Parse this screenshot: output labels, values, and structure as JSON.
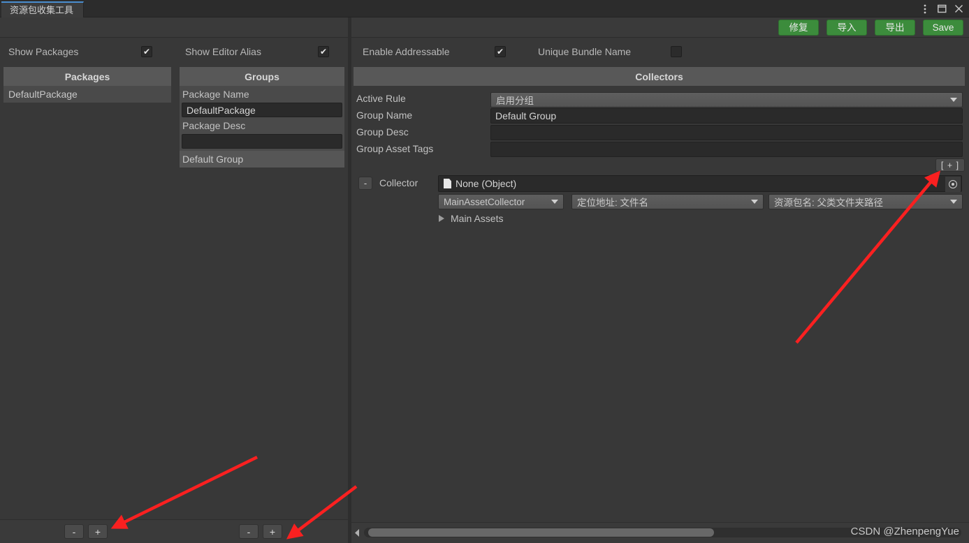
{
  "window": {
    "tab_title": "资源包收集工具",
    "controls": [
      "menu-dots",
      "maximize",
      "close"
    ]
  },
  "toolbar": {
    "buttons": [
      {
        "label": "修复",
        "color": "#3c8c3c"
      },
      {
        "label": "导入",
        "color": "#3c8c3c"
      },
      {
        "label": "导出",
        "color": "#3c8c3c"
      },
      {
        "label": "Save",
        "color": "#3c8c3c"
      }
    ]
  },
  "options": [
    {
      "label": "Show Packages",
      "checked": true
    },
    {
      "label": "Show Editor Alias",
      "checked": true
    },
    {
      "label": "Enable Addressable",
      "checked": true
    },
    {
      "label": "Unique Bundle Name",
      "checked": false
    }
  ],
  "packages_panel": {
    "header": "Packages",
    "items": [
      "DefaultPackage"
    ]
  },
  "groups_panel": {
    "header": "Groups",
    "package_name_label": "Package Name",
    "package_name_value": "DefaultPackage",
    "package_desc_label": "Package Desc",
    "package_desc_value": "",
    "items": [
      "Default Group"
    ]
  },
  "collectors_panel": {
    "header": "Collectors",
    "fields": [
      {
        "label": "Active Rule",
        "value": "启用分组",
        "type": "dropdown"
      },
      {
        "label": "Group Name",
        "value": "Default Group",
        "type": "text"
      },
      {
        "label": "Group Desc",
        "value": "",
        "type": "text"
      },
      {
        "label": "Group Asset Tags",
        "value": "",
        "type": "text"
      }
    ],
    "add_button": "[ + ]",
    "collector": {
      "remove_button": "-",
      "label": "Collector",
      "object_value": "None (Object)",
      "collector_type": "MainAssetCollector",
      "address_rule": "定位地址: 文件名",
      "pack_rule": "资源包名: 父类文件夹路径",
      "foldout_label": "Main Assets"
    }
  },
  "bottom": {
    "packages_minus": "-",
    "packages_plus": "+",
    "groups_minus": "-",
    "groups_plus": "+",
    "watermark": "CSDN @ZhenpengYue"
  }
}
